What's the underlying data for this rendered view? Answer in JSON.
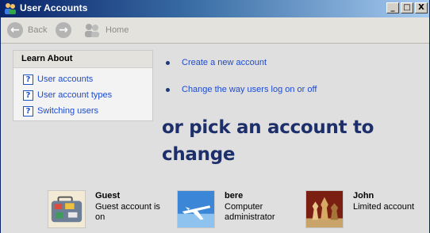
{
  "window": {
    "title": "User Accounts"
  },
  "window_controls": {
    "minimize": "_",
    "maximize": "□",
    "close": "X"
  },
  "toolbar": {
    "back": "Back",
    "home": "Home"
  },
  "learn_about": {
    "heading": "Learn About",
    "items": [
      "User accounts",
      "User account types",
      "Switching users"
    ]
  },
  "tasks": [
    "Create a new account",
    "Change the way users log on or off"
  ],
  "pick_heading": "or pick an account to change",
  "accounts": [
    {
      "name": "Guest",
      "description": "Guest account is on",
      "icon": "suitcase-icon"
    },
    {
      "name": "bere",
      "description": "Computer administrator",
      "icon": "airplane-icon"
    },
    {
      "name": "John",
      "description": "Limited account",
      "icon": "chess-icon"
    }
  ],
  "colors": {
    "title_bar": "#0a246a",
    "link": "#1d4bd0",
    "heading": "#1d2f6a"
  }
}
